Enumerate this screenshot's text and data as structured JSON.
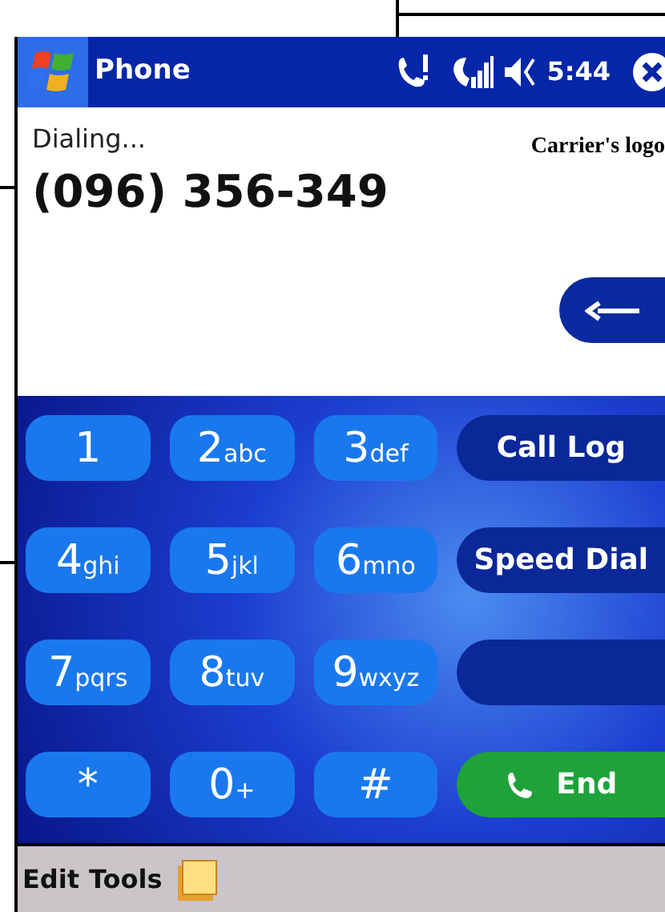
{
  "title_bar": {
    "title": "Phone",
    "time": "5:44"
  },
  "call": {
    "status": "Dialing...",
    "number": "(096) 356-349",
    "carrier_logo": "Carrier's logo"
  },
  "keypad": [
    {
      "digit": "1"
    },
    {
      "digit": "2",
      "letters": "abc"
    },
    {
      "digit": "3",
      "letters": "def"
    },
    {
      "digit": "4",
      "letters": "ghi"
    },
    {
      "digit": "5",
      "letters": "jkl"
    },
    {
      "digit": "6",
      "letters": "mno"
    },
    {
      "digit": "7",
      "letters": "pqrs"
    },
    {
      "digit": "8",
      "letters": "tuv"
    },
    {
      "digit": "9",
      "letters": "wxyz"
    },
    {
      "digit": "*"
    },
    {
      "digit": "0",
      "letters": "+"
    },
    {
      "digit": "#"
    }
  ],
  "side_buttons": [
    {
      "kind": "text",
      "label": "Call Log"
    },
    {
      "kind": "text",
      "label": "Speed Dial"
    },
    {
      "kind": "blank"
    },
    {
      "kind": "end",
      "label": "End"
    }
  ],
  "menu_bar": [
    "Edit",
    "Tools"
  ]
}
